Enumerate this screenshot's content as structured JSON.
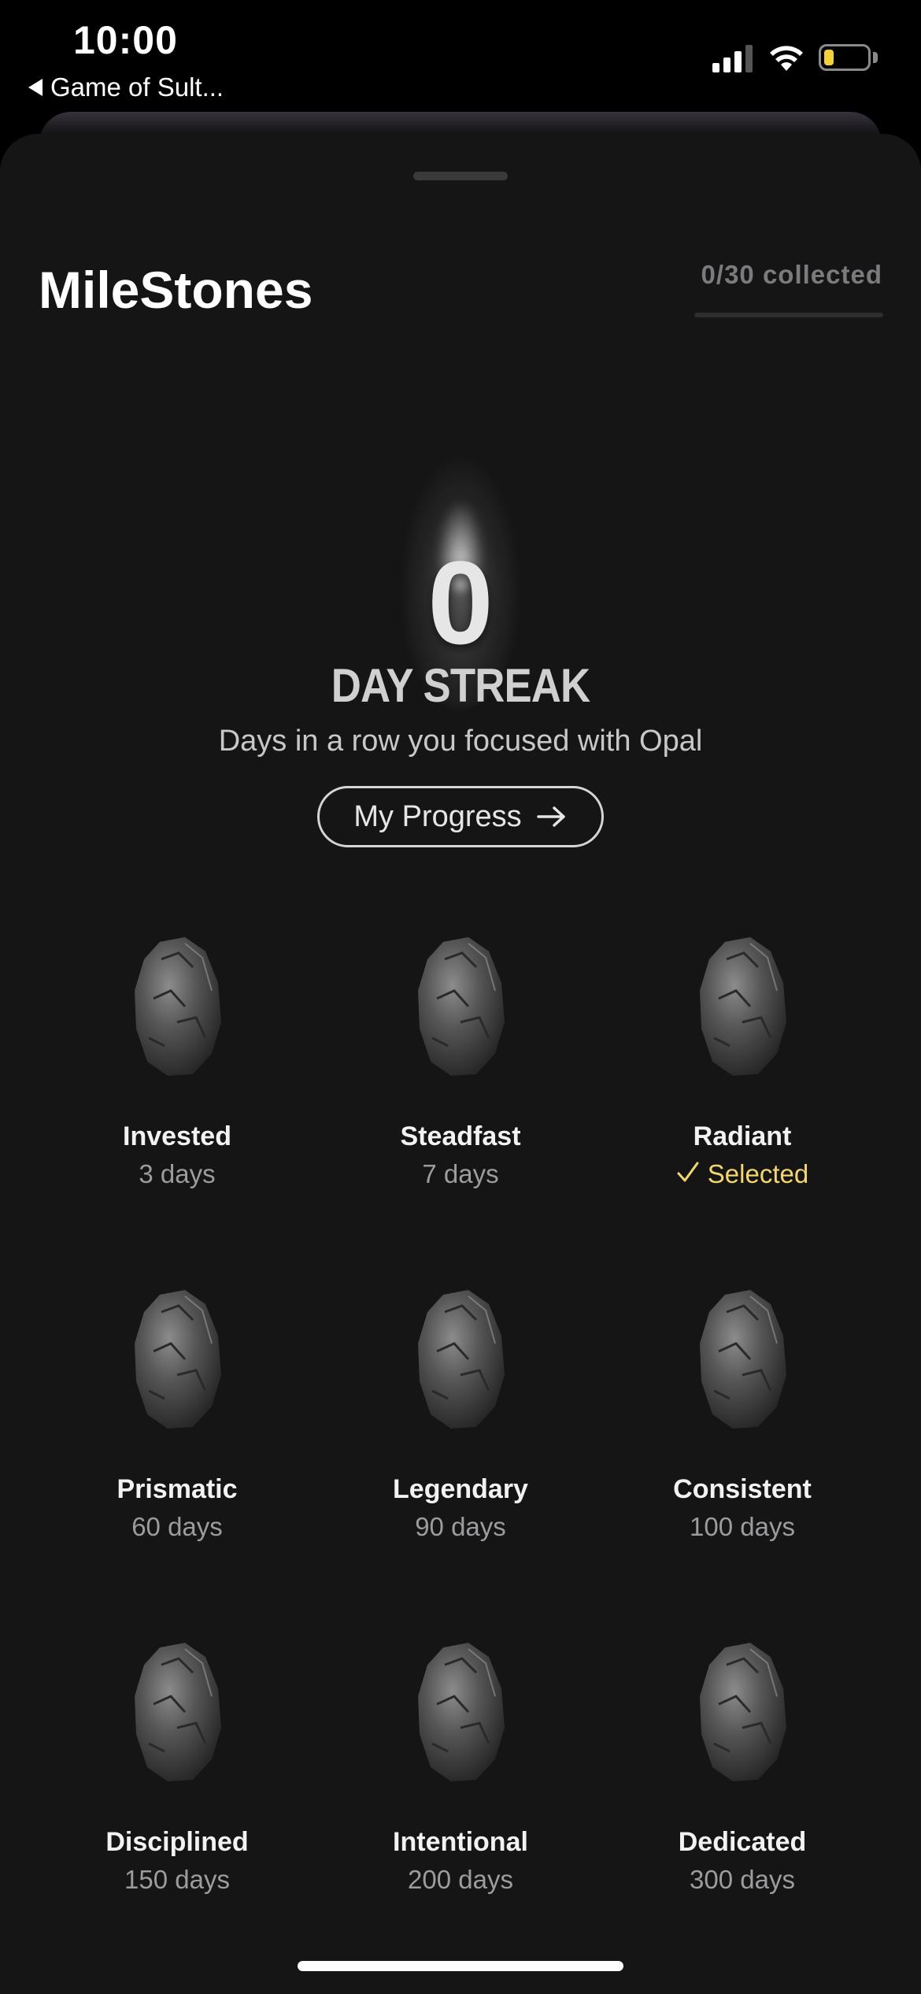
{
  "status_bar": {
    "time": "10:00",
    "back_app": "Game of Sult...",
    "battery_color": "#f4d233"
  },
  "header": {
    "title": "MileStones",
    "collected": "0/30 collected",
    "collected_fraction": 0
  },
  "streak": {
    "count": "0",
    "label": "DAY STREAK",
    "subtitle": "Days in a row you focused with Opal",
    "button_label": "My Progress",
    "button_icon": "arrow-right-icon"
  },
  "milestones": [
    {
      "name": "Invested",
      "days": "3 days",
      "selected": false
    },
    {
      "name": "Steadfast",
      "days": "7 days",
      "selected": false
    },
    {
      "name": "Radiant",
      "days": "Selected",
      "selected": true
    },
    {
      "name": "Prismatic",
      "days": "60 days",
      "selected": false
    },
    {
      "name": "Legendary",
      "days": "90 days",
      "selected": false
    },
    {
      "name": "Consistent",
      "days": "100 days",
      "selected": false
    },
    {
      "name": "Disciplined",
      "days": "150 days",
      "selected": false
    },
    {
      "name": "Intentional",
      "days": "200 days",
      "selected": false
    },
    {
      "name": "Dedicated",
      "days": "300 days",
      "selected": false
    }
  ],
  "colors": {
    "background": "#151516",
    "selected_accent": "#f3d76a",
    "muted_text": "#9c9c9e"
  }
}
